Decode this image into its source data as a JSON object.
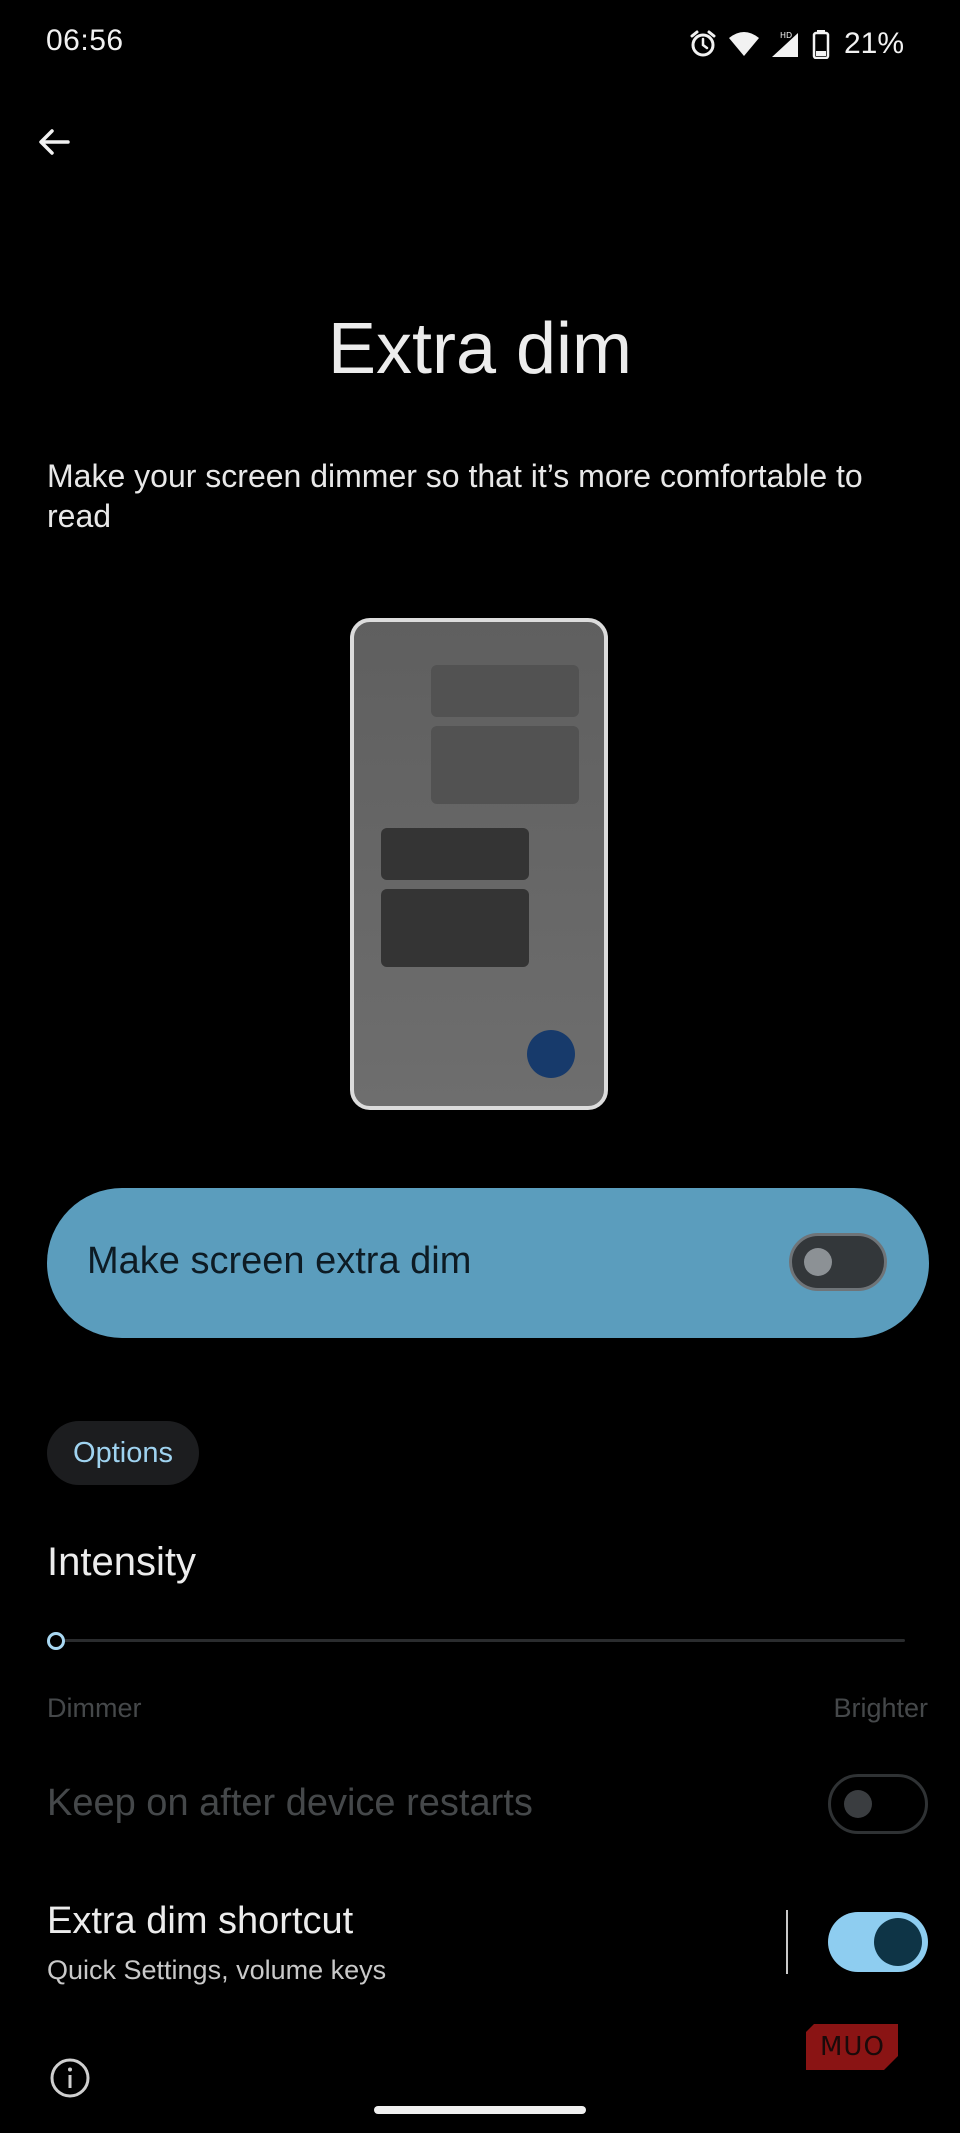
{
  "status_bar": {
    "time": "06:56",
    "battery": "21%",
    "icons": [
      "alarm-icon",
      "wifi-icon",
      "signal-hd-icon",
      "battery-icon"
    ]
  },
  "header": {
    "back_icon": "arrow-back-icon"
  },
  "page": {
    "title": "Extra dim",
    "description": "Make your screen dimmer so that it’s more comfortable to read"
  },
  "main_switch": {
    "label": "Make screen extra dim",
    "checked": false
  },
  "options_chip": "Options",
  "intensity": {
    "title": "Intensity",
    "value": 0,
    "min_label": "Dimmer",
    "max_label": "Brighter"
  },
  "keep_on": {
    "label": "Keep on after device restarts",
    "checked": false,
    "enabled": false
  },
  "shortcut": {
    "title": "Extra dim shortcut",
    "subtitle": "Quick Settings, volume keys",
    "checked": true
  },
  "watermark": "MUO",
  "colors": {
    "background": "#000000",
    "card": "#5b9dbd",
    "accent": "#8ecdf0",
    "chip_text": "#9fd3f0",
    "disabled_text": "#45484a"
  }
}
